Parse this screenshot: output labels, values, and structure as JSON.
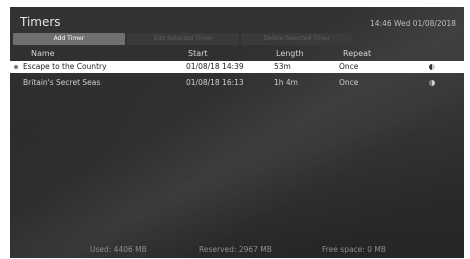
{
  "header": {
    "title": "Timers",
    "datetime": "14:46 Wed 01/08/2018"
  },
  "toolbar": {
    "add_label": "Add Timer",
    "edit_label": "Edit Selected Timer",
    "delete_label": "Delete Selected Timer"
  },
  "columns": {
    "name": "Name",
    "start": "Start",
    "length": "Length",
    "repeat": "Repeat"
  },
  "timers": [
    {
      "name": "Escape to the Country",
      "start": "01/08/18  14:39",
      "length": "53m",
      "repeat": "Once",
      "status_icon": "record-half-icon"
    },
    {
      "name": "Britain's Secret Seas",
      "start": "01/08/18  16:13",
      "length": "1h 4m",
      "repeat": "Once",
      "status_icon": "record-half-icon"
    }
  ],
  "footer": {
    "used": "Used: 4406 MB",
    "reserved": "Reserved: 2967 MB",
    "free": "Free space: 0 MB"
  },
  "colors": {
    "background": "#2b2b2b",
    "selected_row": "#ffffff",
    "active_button": "#6f6f6f"
  }
}
